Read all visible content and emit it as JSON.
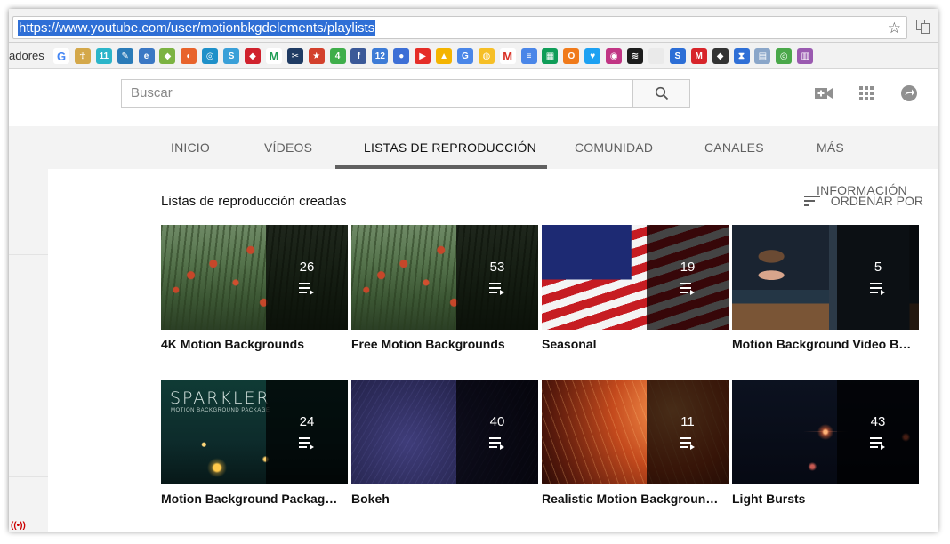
{
  "browser": {
    "url": "https://www.youtube.com/user/motionbkgdelements/playlists",
    "bookmarks_label": "adores",
    "bookmark_icons": [
      {
        "name": "google-icon",
        "color": "#ffffff",
        "glyph": "G"
      },
      {
        "name": "figure-icon",
        "color": "#d4a84a",
        "glyph": "☥"
      },
      {
        "name": "teal-app-icon",
        "color": "#2bb5c9",
        "glyph": "11"
      },
      {
        "name": "blue-draw-icon",
        "color": "#2a7bb8",
        "glyph": "✎"
      },
      {
        "name": "blue-circle-icon",
        "color": "#3b78c4",
        "glyph": "e"
      },
      {
        "name": "android-icon",
        "color": "#7cb342",
        "glyph": "◆"
      },
      {
        "name": "orange-app-icon",
        "color": "#e8632b",
        "glyph": "◐"
      },
      {
        "name": "ring-icon",
        "color": "#1e90c9",
        "glyph": "◎"
      },
      {
        "name": "swirl-icon",
        "color": "#3aa0d8",
        "glyph": "S"
      },
      {
        "name": "red-shape-icon",
        "color": "#d0222d",
        "glyph": "◆"
      },
      {
        "name": "m-green-icon",
        "color": "#ffffff",
        "glyph": "M"
      },
      {
        "name": "scissors-icon",
        "color": "#1f3b63",
        "glyph": "✂"
      },
      {
        "name": "red-square-icon",
        "color": "#d3402c",
        "glyph": "★"
      },
      {
        "name": "green-four-icon",
        "color": "#3fae4a",
        "glyph": "4"
      },
      {
        "name": "facebook-icon",
        "color": "#3b5998",
        "glyph": "f"
      },
      {
        "name": "calendar-icon",
        "color": "#3d7bd6",
        "glyph": "12"
      },
      {
        "name": "contacts-icon",
        "color": "#3d6fd6",
        "glyph": "●"
      },
      {
        "name": "youtube-icon",
        "color": "#e52d27",
        "glyph": "▶"
      },
      {
        "name": "drive-icon",
        "color": "#f4b400",
        "glyph": "▲"
      },
      {
        "name": "translate-icon",
        "color": "#4a86e8",
        "glyph": "G"
      },
      {
        "name": "keep-icon",
        "color": "#f6bf26",
        "glyph": "◍"
      },
      {
        "name": "gmail-icon",
        "color": "#ffffff",
        "glyph": "M"
      },
      {
        "name": "docs-icon",
        "color": "#4a86e8",
        "glyph": "≡"
      },
      {
        "name": "sheets-icon",
        "color": "#0f9d58",
        "glyph": "▦"
      },
      {
        "name": "orange-o-icon",
        "color": "#f07a1a",
        "glyph": "O"
      },
      {
        "name": "twitter-icon",
        "color": "#1da1f2",
        "glyph": "♥"
      },
      {
        "name": "instagram-icon",
        "color": "#c13584",
        "glyph": "◉"
      },
      {
        "name": "spotify-icon",
        "color": "#1d1d1d",
        "glyph": "≋"
      },
      {
        "name": "blank-page-icon",
        "color": "#eaeaea",
        "glyph": " "
      },
      {
        "name": "blue-s-icon",
        "color": "#2c6ed6",
        "glyph": "S"
      },
      {
        "name": "red-m-icon",
        "color": "#d7242a",
        "glyph": "M"
      },
      {
        "name": "mask-icon",
        "color": "#333333",
        "glyph": "◆"
      },
      {
        "name": "hourglass-icon",
        "color": "#2f6fd6",
        "glyph": "⧗"
      },
      {
        "name": "printer-icon",
        "color": "#8aa6c9",
        "glyph": "▤"
      },
      {
        "name": "green-ring-icon",
        "color": "#4aa84a",
        "glyph": "◎"
      },
      {
        "name": "purple-icon",
        "color": "#9a5ab0",
        "glyph": "▥"
      }
    ]
  },
  "search": {
    "placeholder": "Buscar"
  },
  "tabs": [
    {
      "label": "INICIO"
    },
    {
      "label": "VÍDEOS"
    },
    {
      "label": "LISTAS DE REPRODUCCIÓN",
      "active": true
    },
    {
      "label": "COMUNIDAD"
    },
    {
      "label": "CANALES"
    },
    {
      "label": "MÁS INFORMACIÓN"
    }
  ],
  "section": {
    "title": "Listas de reproducción creadas",
    "sort_label": "ORDENAR POR"
  },
  "playlists": [
    {
      "title": "4K Motion Backgrounds",
      "count": "26",
      "art": "field"
    },
    {
      "title": "Free Motion Backgrounds",
      "count": "53",
      "art": "field"
    },
    {
      "title": "Seasonal",
      "count": "19",
      "art": "flag"
    },
    {
      "title": "Motion Background Video B…",
      "count": "5",
      "art": "studio"
    },
    {
      "title": "Motion Background Packag…",
      "count": "24",
      "art": "spark",
      "art_text": "SPARKLER",
      "art_subtext": "MOTION BACKGROUND PACKAGE"
    },
    {
      "title": "Bokeh",
      "count": "40",
      "art": "bokeh"
    },
    {
      "title": "Realistic Motion Backgroun…",
      "count": "11",
      "art": "grass"
    },
    {
      "title": "Light Bursts",
      "count": "43",
      "art": "light"
    }
  ]
}
